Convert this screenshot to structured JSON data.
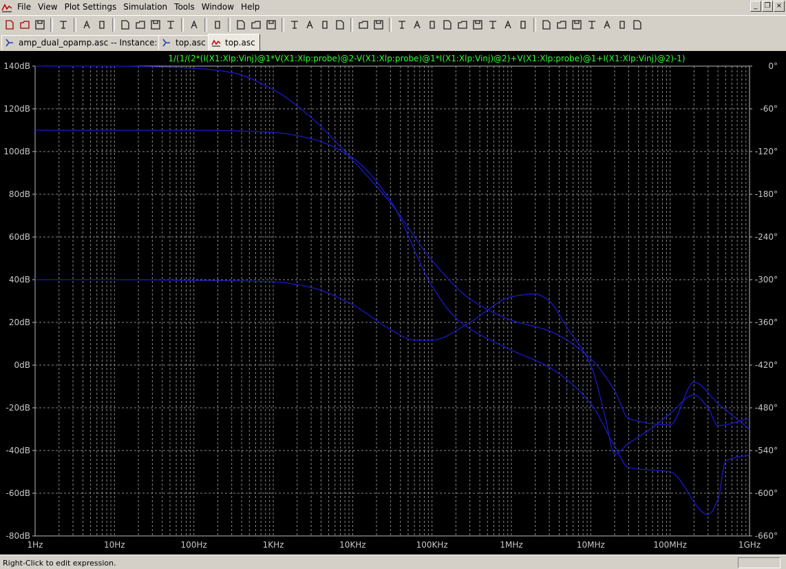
{
  "menu": {
    "items": [
      "File",
      "View",
      "Plot Settings",
      "Simulation",
      "Tools",
      "Window",
      "Help"
    ]
  },
  "window_controls": {
    "minimize": "_",
    "restore": "❐",
    "close": "×"
  },
  "toolbar": {
    "icons": [
      "new-schematic-icon",
      "open-icon",
      "save-icon",
      "control-panel-icon",
      "run-icon",
      "halt-icon",
      "zoom-in-icon",
      "zoom-out-icon",
      "zoom-back-icon",
      "zoom-cancel-icon",
      "autorange-icon",
      "cursor-icon",
      "tile-horizontal-icon",
      "cascade-icon",
      "tile-vertical-icon",
      "cut-icon",
      "copy-icon",
      "paste-icon",
      "find-icon",
      "print-setup-icon",
      "print-icon",
      "wire-icon",
      "ground-icon",
      "label-icon",
      "resistor-icon",
      "capacitor-icon",
      "inductor-icon",
      "diode-icon",
      "component-icon",
      "move-icon",
      "drag-icon",
      "undo-icon",
      "redo-icon",
      "rotate-icon",
      "mirror-icon",
      "text-icon",
      "spice-directive-icon"
    ]
  },
  "tabs": [
    {
      "label": "amp_dual_opamp.asc -- Instance: X1",
      "active": false
    },
    {
      "label": "top.asc",
      "active": false
    },
    {
      "label": "top.asc",
      "active": true
    }
  ],
  "status": {
    "text": "Right-Click to edit expression."
  },
  "colors": {
    "background": "#000000",
    "grid": "#8a8a8a",
    "trace": "#1a1acc",
    "title": "#33ff33",
    "axis_text": "#c8c8c8"
  },
  "chart_data": {
    "type": "line",
    "title": "1/(1/(2*(I(X1:Xlp:Vinj)@1*V(X1:Xlp:probe)@2-V(X1:Xlp:probe)@1*I(X1:Xlp:Vinj)@2)+V(X1:Xlp:probe)@1+I(X1:Xlp:Vinj)@2)-1)",
    "x_scale": "log",
    "xlim": [
      1,
      1000000000
    ],
    "x_ticks": [
      "1Hz",
      "10Hz",
      "100Hz",
      "1KHz",
      "10KHz",
      "100KHz",
      "1MHz",
      "10MHz",
      "100MHz",
      "1GHz"
    ],
    "ylim_left": [
      -80,
      140
    ],
    "y_ticks_left": [
      "140dB",
      "120dB",
      "100dB",
      "80dB",
      "60dB",
      "40dB",
      "20dB",
      "0dB",
      "-20dB",
      "-40dB",
      "-60dB",
      "-80dB"
    ],
    "ylim_right": [
      -660,
      0
    ],
    "y_ticks_right": [
      "0°",
      "-60°",
      "-120°",
      "-180°",
      "-240°",
      "-300°",
      "-360°",
      "-420°",
      "-480°",
      "-540°",
      "-600°",
      "-660°"
    ],
    "grid": true,
    "series": [
      {
        "axis": "left",
        "x": [
          1,
          10,
          100,
          300,
          1000,
          3000,
          10000,
          30000,
          100000,
          300000,
          1000000,
          3000000,
          10000000,
          20000000,
          30000000,
          100000000,
          200000000,
          400000000,
          1000000000
        ],
        "values": [
          140,
          140,
          139,
          137,
          129,
          116,
          96,
          76,
          49,
          31,
          21,
          16,
          3,
          -12,
          -25,
          -28,
          -8,
          -18,
          -30
        ]
      },
      {
        "axis": "right",
        "x": [
          1,
          10,
          100,
          1000,
          3000,
          10000,
          30000,
          60000,
          100000,
          300000,
          1000000,
          2000000,
          3000000,
          5000000,
          10000000,
          15000000,
          20000000,
          30000000,
          60000000,
          100000000,
          200000000,
          300000000,
          400000000,
          1000000000
        ],
        "values": [
          -300,
          -300,
          -301,
          -303,
          -311,
          -335,
          -370,
          -385,
          -385,
          -360,
          -324,
          -320,
          -330,
          -367,
          -420,
          -490,
          -545,
          -530,
          -508,
          -488,
          -462,
          -480,
          -505,
          -495
        ]
      },
      {
        "axis": "left",
        "x": [
          1,
          10,
          100,
          1000,
          3000,
          10000,
          30000,
          100000,
          200000,
          300000,
          1000000,
          3000000,
          10000000,
          20000000,
          30000000,
          100000000,
          300000000,
          400000000,
          500000000,
          1000000000
        ],
        "values": [
          110,
          110,
          110,
          109,
          106,
          97,
          77,
          37,
          22,
          17,
          7,
          -1,
          -18,
          -38,
          -48,
          -50,
          -70,
          -63,
          -45,
          -42
        ]
      }
    ]
  }
}
